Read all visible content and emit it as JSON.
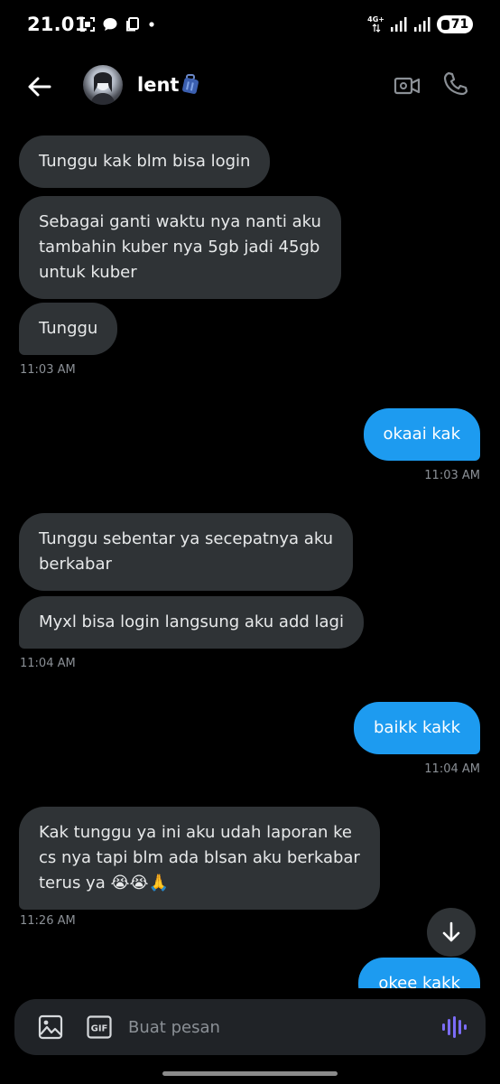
{
  "status_bar": {
    "time": "21.01",
    "network": "4G+",
    "battery": "71"
  },
  "header": {
    "contact_name": "lent",
    "name_emoji_icon": "suitcase-icon"
  },
  "messages": [
    {
      "direction": "in",
      "text": "Tunggu kak blm bisa login"
    },
    {
      "direction": "in",
      "text": "Sebagai ganti waktu nya nanti aku\ntambahin kuber nya 5gb jadi 45gb\nuntuk kuber"
    },
    {
      "direction": "in",
      "text": "Tunggu"
    },
    {
      "time": "11:03 AM"
    },
    {
      "direction": "out",
      "text": "okaai kak"
    },
    {
      "time": "11:03 AM"
    },
    {
      "direction": "in",
      "text": "Tunggu sebentar ya secepatnya aku\nberkabar"
    },
    {
      "direction": "in",
      "text": "Myxl bisa login langsung aku add lagi"
    },
    {
      "time": "11:04 AM"
    },
    {
      "direction": "out",
      "text": "baikk kakk"
    },
    {
      "time": "11:04 AM"
    },
    {
      "direction": "in",
      "text": "Kak tunggu ya ini aku udah laporan ke\ncs nya tapi blm ada blsan aku berkabar\nterus ya 😭😭🙏"
    },
    {
      "time": "11:26 AM"
    },
    {
      "direction": "out",
      "text": "okee kakk"
    }
  ],
  "composer": {
    "placeholder": "Buat pesan",
    "gif_label": "GIF"
  },
  "colors": {
    "background": "#000000",
    "incoming_bubble": "#2f3336",
    "outgoing_bubble": "#1d9bf0",
    "timestamp": "#8b9096",
    "voice_accent": "#7b6cf6"
  }
}
